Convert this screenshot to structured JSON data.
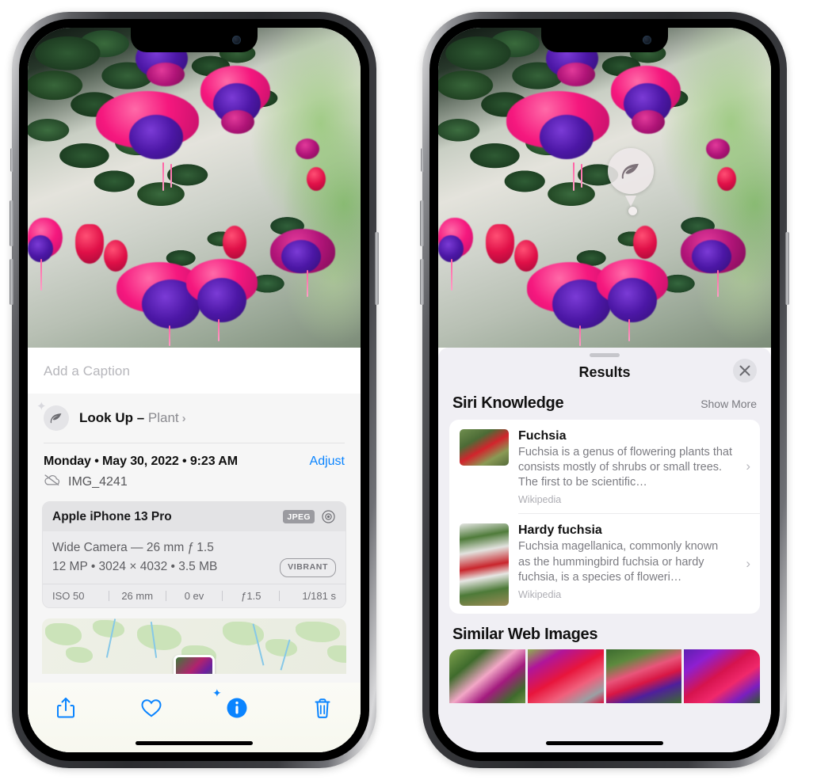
{
  "left_phone": {
    "photo": {
      "alt": "fuchsia-flowers-hanging-basket"
    },
    "caption_field": {
      "placeholder": "Add a Caption",
      "value": ""
    },
    "lookup": {
      "icon": "leaf-icon",
      "sparkle_icon": "sparkle-icon",
      "label": "Look Up – ",
      "subject": "Plant",
      "chevron": "›"
    },
    "date_row": {
      "date_text": "Monday • May 30, 2022 • 9:23 AM",
      "adjust_label": "Adjust"
    },
    "file_row": {
      "icon": "cloud-slash-icon",
      "filename": "IMG_4241"
    },
    "metadata_card": {
      "device": "Apple iPhone 13 Pro",
      "format_badge": "JPEG",
      "aperture_icon": "aperture-icon",
      "lens_line": "Wide Camera — 26 mm ƒ 1.5",
      "size_line": "12 MP • 3024 × 4032 • 3.5 MB",
      "style_badge": "VIBRANT",
      "exif": [
        "ISO 50",
        "26 mm",
        "0 ev",
        "ƒ1.5",
        "1/181 s"
      ]
    },
    "toolbar": [
      {
        "name": "share-icon",
        "label": "Share"
      },
      {
        "name": "heart-icon",
        "label": "Favorite"
      },
      {
        "name": "info-icon",
        "label": "Info"
      },
      {
        "name": "trash-icon",
        "label": "Delete"
      }
    ]
  },
  "right_phone": {
    "photo": {
      "alt": "fuchsia-flowers-hanging-basket"
    },
    "leaf_badge": {
      "icon": "leaf-icon"
    },
    "sheet": {
      "grabber": "drag-handle",
      "title": "Results",
      "close_icon": "close-icon"
    },
    "siri_knowledge": {
      "section_title": "Siri Knowledge",
      "show_more": "Show More",
      "items": [
        {
          "title": "Fuchsia",
          "description": "Fuchsia is a genus of flowering plants that consists mostly of shrubs or small trees. The first to be scientific…",
          "source": "Wikipedia",
          "chevron": "›",
          "thumb": "fuchsia-red-flowers-thumb"
        },
        {
          "title": "Hardy fuchsia",
          "description": "Fuchsia magellanica, commonly known as the hummingbird fuchsia or hardy fuchsia, is a species of floweri…",
          "source": "Wikipedia",
          "chevron": "›",
          "thumb": "hardy-fuchsia-branch-thumb"
        }
      ]
    },
    "similar_web_images": {
      "section_title": "Similar Web Images",
      "images": [
        {
          "alt": "pink-white-fuchsia-leaves"
        },
        {
          "alt": "red-fuchsia-closeup"
        },
        {
          "alt": "fuchsia-buds-bush"
        },
        {
          "alt": "purple-red-fuchsia-cluster"
        }
      ]
    }
  },
  "colors": {
    "accent_blue": "#0a84ff",
    "sheet_bg": "#f0eff4",
    "card_bg": "#ffffff",
    "meta_card_bg": "#ececee",
    "text_primary": "#111111",
    "text_secondary": "#7c7c82"
  }
}
